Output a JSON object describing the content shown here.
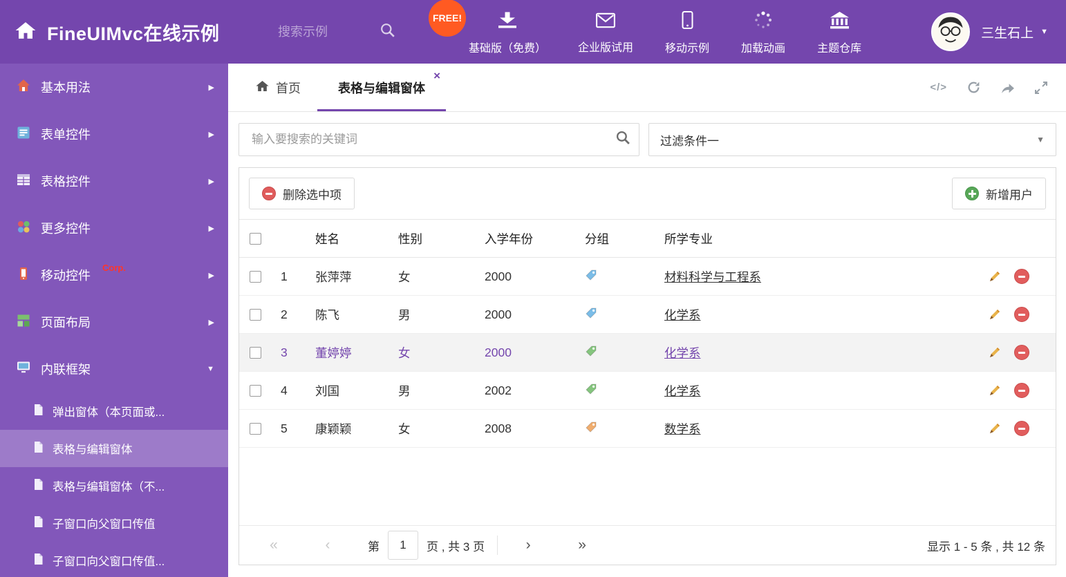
{
  "colors": {
    "accent": "#7446ad",
    "sidebar_bg": "#8257ba",
    "free_badge": "#ff5a22",
    "corp_red": "#ff352a",
    "tag_blue": "#7bbde8",
    "tag_green": "#85c57e",
    "tag_orange": "#f0ad6e",
    "delete_red": "#e15d5d",
    "add_green": "#58a758"
  },
  "icons": {
    "chevron_right": "▶",
    "caret_down": "▼",
    "close": "×",
    "code": "</>",
    "first": "«",
    "prev": "‹",
    "next": "›",
    "last": "»"
  },
  "header": {
    "title": "FineUIMvc在线示例",
    "search_placeholder": "搜索示例",
    "free_badge": "FREE!",
    "nav": [
      {
        "label": "基础版（免费）",
        "icon": "download-icon"
      },
      {
        "label": "企业版试用",
        "icon": "envelope-icon"
      },
      {
        "label": "移动示例",
        "icon": "mobile-icon"
      },
      {
        "label": "加载动画",
        "icon": "spinner-icon"
      },
      {
        "label": "主题仓库",
        "icon": "museum-icon"
      }
    ],
    "username": "三生石上"
  },
  "sidebar": {
    "groups": [
      {
        "label": "基本用法",
        "icon": "home-icon"
      },
      {
        "label": "表单控件",
        "icon": "form-icon"
      },
      {
        "label": "表格控件",
        "icon": "table-icon"
      },
      {
        "label": "更多控件",
        "icon": "more-icon"
      },
      {
        "label": "移动控件",
        "icon": "mobile-icon",
        "badge": "Corp."
      },
      {
        "label": "页面布局",
        "icon": "layout-icon"
      },
      {
        "label": "内联框架",
        "icon": "frame-icon",
        "expanded": true
      }
    ],
    "children": [
      {
        "label": "弹出窗体（本页面或..."
      },
      {
        "label": "表格与编辑窗体",
        "selected": true
      },
      {
        "label": "表格与编辑窗体（不..."
      },
      {
        "label": "子窗口向父窗口传值"
      },
      {
        "label": "子窗口向父窗口传值..."
      }
    ]
  },
  "tabs": {
    "home_label": "首页",
    "active_label": "表格与编辑窗体"
  },
  "filters": {
    "search_placeholder": "输入要搜索的关键词",
    "filter_value": "过滤条件一"
  },
  "toolbar": {
    "delete_label": "删除选中项",
    "add_label": "新增用户"
  },
  "table": {
    "columns": [
      "姓名",
      "性别",
      "入学年份",
      "分组",
      "所学专业"
    ],
    "rows": [
      {
        "num": "1",
        "name": "张萍萍",
        "gender": "女",
        "year": "2000",
        "tag": "blue",
        "tag_color": "#7bbde8",
        "major": "材料科学与工程系"
      },
      {
        "num": "2",
        "name": "陈飞",
        "gender": "男",
        "year": "2000",
        "tag": "blue",
        "tag_color": "#7bbde8",
        "major": "化学系"
      },
      {
        "num": "3",
        "name": "董婷婷",
        "gender": "女",
        "year": "2000",
        "tag": "green",
        "tag_color": "#85c57e",
        "major": "化学系",
        "selected": true
      },
      {
        "num": "4",
        "name": "刘国",
        "gender": "男",
        "year": "2002",
        "tag": "green",
        "tag_color": "#85c57e",
        "major": "化学系"
      },
      {
        "num": "5",
        "name": "康颖颖",
        "gender": "女",
        "year": "2008",
        "tag": "orange",
        "tag_color": "#f0ad6e",
        "major": "数学系"
      }
    ]
  },
  "pagination": {
    "page_prefix": "第",
    "page": "1",
    "page_suffix": "页 , 共 3 页",
    "summary": "显示 1 - 5 条 , 共 12 条"
  }
}
